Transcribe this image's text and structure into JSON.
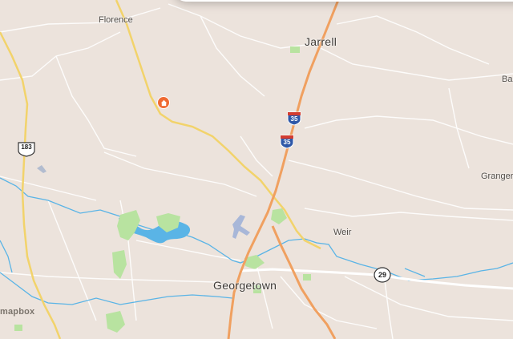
{
  "map": {
    "labels": {
      "florence": "Florence",
      "jarrell": "Jarrell",
      "georgetown": "Georgetown",
      "weir": "Weir",
      "granger": "Granger",
      "ba": "Ba"
    },
    "shields": {
      "us183": "183",
      "i35_a": "35",
      "i35_b": "35",
      "sh29": "29"
    },
    "attribution": "mapbox",
    "colors": {
      "land": "#ece3dc",
      "interstate": "#f0a060",
      "highway": "#f2d36b",
      "water": "#5ab4e6",
      "park": "#b8e3a0",
      "minor_road": "#ffffff"
    },
    "icons": [
      "home-marker-icon",
      "airport-icon"
    ]
  }
}
